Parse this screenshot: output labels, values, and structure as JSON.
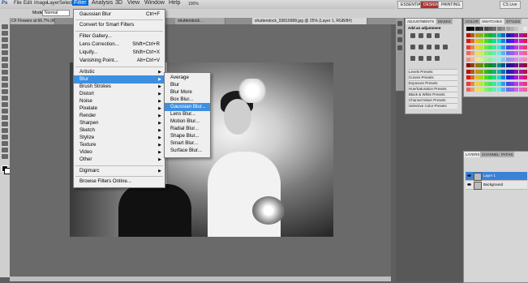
{
  "menubar": {
    "logo": "Ps",
    "items": [
      "File",
      "Edit",
      "Image",
      "Layer",
      "Select",
      "Filter",
      "Analysis",
      "3D",
      "View",
      "Window",
      "Help"
    ],
    "zoom": "100%"
  },
  "workspace": {
    "buttons": [
      "ESSENTIALS",
      "DESIGN",
      "PAINTING"
    ],
    "cslive": "CS Live"
  },
  "options": {
    "mode_label": "Mode:",
    "mode_value": "Normal"
  },
  "tabs": [
    {
      "label": "CF Flowers at 66.7% (RGB/8)"
    },
    {
      "label": "shutterstock..."
    },
    {
      "label": "shutterstock_93816988.jpg @ 25% (Layer 1, RGB/8#)"
    }
  ],
  "filter_menu": {
    "items": [
      {
        "label": "Gaussian Blur",
        "shortcut": "Ctrl+F"
      },
      {
        "label": "Convert for Smart Filters",
        "shortcut": ""
      },
      {
        "label": "Filter Gallery...",
        "shortcut": ""
      },
      {
        "label": "Lens Correction...",
        "shortcut": "Shift+Ctrl+R"
      },
      {
        "label": "Liquify...",
        "shortcut": "Shift+Ctrl+X"
      },
      {
        "label": "Vanishing Point...",
        "shortcut": "Alt+Ctrl+V"
      },
      {
        "label": "Artistic",
        "sub": true
      },
      {
        "label": "Blur",
        "sub": true
      },
      {
        "label": "Brush Strokes",
        "sub": true
      },
      {
        "label": "Distort",
        "sub": true
      },
      {
        "label": "Noise",
        "sub": true
      },
      {
        "label": "Pixelate",
        "sub": true
      },
      {
        "label": "Render",
        "sub": true
      },
      {
        "label": "Sharpen",
        "sub": true
      },
      {
        "label": "Sketch",
        "sub": true
      },
      {
        "label": "Stylize",
        "sub": true
      },
      {
        "label": "Texture",
        "sub": true
      },
      {
        "label": "Video",
        "sub": true
      },
      {
        "label": "Other",
        "sub": true
      },
      {
        "label": "Digimarc",
        "sub": true
      },
      {
        "label": "Browse Filters Online...",
        "shortcut": ""
      }
    ]
  },
  "blur_menu": {
    "items": [
      "Average",
      "Blur",
      "Blur More",
      "Box Blur...",
      "Gaussian Blur...",
      "Lens Blur...",
      "Motion Blur...",
      "Radial Blur...",
      "Shape Blur...",
      "Smart Blur...",
      "Surface Blur..."
    ]
  },
  "adjustments": {
    "tabs": [
      "ADJUSTMENTS",
      "MASKS"
    ],
    "header": "Add an adjustment",
    "presets": [
      "Levels Presets",
      "Curves Presets",
      "Exposure Presets",
      "Hue/Saturation Presets",
      "Black & White Presets",
      "Channel Mixer Presets",
      "Selective Color Presets"
    ]
  },
  "swatches": {
    "tabs": [
      "COLOR",
      "SWATCHES",
      "STYLES"
    ]
  },
  "layers": {
    "tabs": [
      "LAYERS",
      "CHANNELS",
      "PATHS"
    ],
    "rows": [
      {
        "name": "Layer 1",
        "selected": true
      },
      {
        "name": "Background",
        "selected": false
      }
    ]
  },
  "colors": {
    "menu_highlight": "#3d8fe0",
    "design_button": "#a33333",
    "layer_selected": "#3a82d6"
  }
}
